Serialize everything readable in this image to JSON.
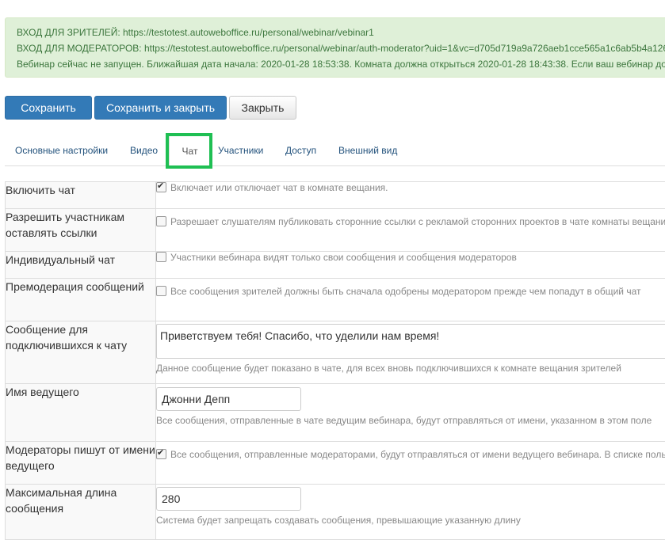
{
  "alert": {
    "viewers_label": "ВХОД ДЛЯ ЗРИТЕЛЕЙ: ",
    "viewers_url": "https://testotest.autowebofﬁce.ru/personal/webinar/vebinar1",
    "moderators_label": "ВХОД ДЛЯ МОДЕРАТОРОВ: ",
    "moderators_url": "https://testotest.autowebofﬁce.ru/personal/webinar/auth-moderator?uid=1&vc=d705d719a9a726aeb1cce565a1c6ab5b4a126",
    "status_text": "Вебинар сейчас не запущен. Ближайшая дата начала: 2020-01-28 18:53:38. Комната должна открыться 2020-01-28 18:43:38. Если ваш вебинар до"
  },
  "buttons": {
    "save": "Сохранить",
    "save_close": "Сохранить и закрыть",
    "close": "Закрыть"
  },
  "tabs": [
    {
      "label": "Основные настройки"
    },
    {
      "label": "Видео"
    },
    {
      "label": "Чат",
      "active": true
    },
    {
      "label": "Участники"
    },
    {
      "label": "Доступ"
    },
    {
      "label": "Внешний вид"
    }
  ],
  "rows": [
    {
      "label": "Включить чат",
      "checked": true,
      "text": "Включает или отключает чат в комнате вещания."
    },
    {
      "label": "Разрешить участникам оставлять ссылки",
      "checked": false,
      "text": "Разрешает слушателям публиковать сторонние ссылки с рекламой сторонних проектов в чате комнаты вещани"
    },
    {
      "label": "Индивидуальный чат",
      "checked": false,
      "text": "Участники вебинара видят только свои сообщения и сообщения модераторов"
    },
    {
      "label": "Премодерация сообщений",
      "checked": false,
      "text": "Все сообщения зрителей должны быть сначала одобрены модератором прежде чем попадут в общий чат"
    },
    {
      "label": "Сообщение для подключившихся к чату",
      "value": "Приветствуем тебя! Спасибо, что уделили нам время!",
      "help": "Данное сообщение будет показано в чате, для всех вновь подключившихся к комнате вещания зрителей"
    },
    {
      "label": "Имя ведущего",
      "value": "Джонни Депп",
      "help": "Все сообщения, отправленные в чате ведущим вебинара, будут отправляться от имени, указанном в этом поле"
    },
    {
      "label": "Модераторы пишут от имени ведущего",
      "checked": true,
      "text": "Все сообщения, отправленные модераторами, будут отправляться от имени ведущего вебинара. В списке поль"
    },
    {
      "label": "Максимальная длина сообщения",
      "value": "280",
      "help": "Система будет запрещать создавать сообщения, превышающие указанную длину"
    }
  ],
  "colors": {
    "primary": "#337ab7",
    "alert_bg": "#dff0d8",
    "alert_text": "#3c763d",
    "highlight": "#1fbf53"
  }
}
